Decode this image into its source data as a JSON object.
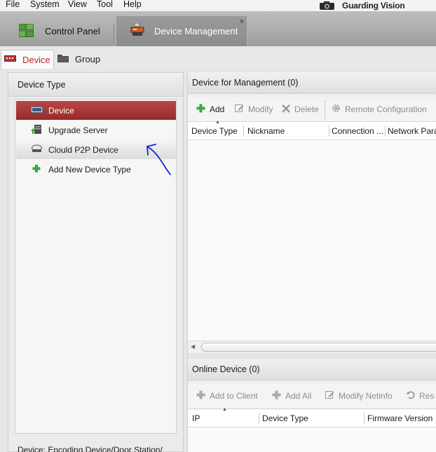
{
  "menubar": {
    "items": [
      "File",
      "System",
      "View",
      "Tool",
      "Help"
    ]
  },
  "brand": {
    "name": "Guarding Vision",
    "icon": "camera-logo-icon"
  },
  "tabs": [
    {
      "label": "Control Panel",
      "icon": "control-panel-grid-icon",
      "active": false
    },
    {
      "label": "Device Management",
      "icon": "device-management-icon",
      "active": true,
      "close": "×"
    }
  ],
  "subtabs": [
    {
      "label": "Device",
      "icon": "device-icon",
      "active": true
    },
    {
      "label": "Group",
      "icon": "folder-icon",
      "active": false
    }
  ],
  "left_panel": {
    "title": "Device Type",
    "items": [
      {
        "label": "Device",
        "icon": "device-icon",
        "state": "selected"
      },
      {
        "label": "Upgrade Server",
        "icon": "upgrade-server-icon",
        "state": "normal"
      },
      {
        "label": "Clould P2P Device",
        "icon": "cloud-device-icon",
        "state": "hover"
      },
      {
        "label": "Add New Device Type",
        "icon": "plus-icon",
        "state": "normal"
      }
    ],
    "bottom_text": "Device: Encoding Device/Door Station/"
  },
  "management": {
    "title": "Device for Management (0)",
    "toolbar": {
      "add": "Add",
      "modify": "Modify",
      "delete": "Delete",
      "remote_config": "Remote Configuration"
    },
    "columns": [
      "Device Type",
      "Nickname",
      "Connection ...",
      "Network Para"
    ]
  },
  "online": {
    "title": "Online Device (0)",
    "toolbar": {
      "add_to_client": "Add to Client",
      "add_all": "Add All",
      "modify_netinfo": "Modify Netinfo",
      "reset": "Res"
    },
    "columns": [
      "IP",
      "Device Type",
      "Firmware Version"
    ]
  },
  "colors": {
    "accent": "#a83434",
    "add_green": "#3aa83a",
    "annotation_blue": "#1428c8"
  }
}
